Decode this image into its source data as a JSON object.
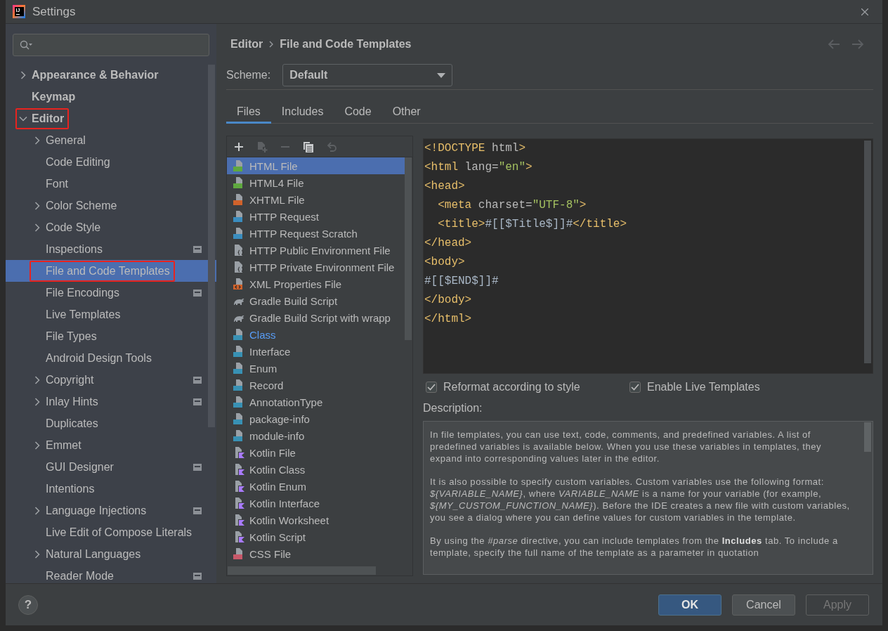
{
  "window": {
    "title": "Settings",
    "logo_text": "IJ"
  },
  "sidebar": {
    "items": [
      {
        "label": "Appearance & Behavior",
        "expanded": false,
        "selected": false,
        "marked": false,
        "project_setting": false
      },
      {
        "label": "Keymap",
        "selected": false,
        "marked": false,
        "project_setting": false
      },
      {
        "label": "Editor",
        "expanded": true,
        "selected": false,
        "marked": true,
        "project_setting": false,
        "children": [
          {
            "label": "General",
            "expanded": false,
            "selected": false,
            "marked": false,
            "project_setting": false
          },
          {
            "label": "Code Editing",
            "selected": false,
            "marked": false,
            "project_setting": false
          },
          {
            "label": "Font",
            "selected": false,
            "marked": false,
            "project_setting": false
          },
          {
            "label": "Color Scheme",
            "expanded": false,
            "selected": false,
            "marked": false,
            "project_setting": false
          },
          {
            "label": "Code Style",
            "expanded": false,
            "selected": false,
            "marked": false,
            "project_setting": false
          },
          {
            "label": "Inspections",
            "selected": false,
            "marked": false,
            "project_setting": true
          },
          {
            "label": "File and Code Templates",
            "selected": true,
            "marked": true,
            "project_setting": false
          },
          {
            "label": "File Encodings",
            "selected": false,
            "marked": false,
            "project_setting": true
          },
          {
            "label": "Live Templates",
            "selected": false,
            "marked": false,
            "project_setting": false
          },
          {
            "label": "File Types",
            "selected": false,
            "marked": false,
            "project_setting": false
          },
          {
            "label": "Android Design Tools",
            "selected": false,
            "marked": false,
            "project_setting": false
          },
          {
            "label": "Copyright",
            "expanded": false,
            "selected": false,
            "marked": false,
            "project_setting": true
          },
          {
            "label": "Inlay Hints",
            "expanded": false,
            "selected": false,
            "marked": false,
            "project_setting": true
          },
          {
            "label": "Duplicates",
            "selected": false,
            "marked": false,
            "project_setting": false
          },
          {
            "label": "Emmet",
            "expanded": false,
            "selected": false,
            "marked": false,
            "project_setting": false
          },
          {
            "label": "GUI Designer",
            "selected": false,
            "marked": false,
            "project_setting": true
          },
          {
            "label": "Intentions",
            "selected": false,
            "marked": false,
            "project_setting": false
          },
          {
            "label": "Language Injections",
            "expanded": false,
            "selected": false,
            "marked": false,
            "project_setting": true
          },
          {
            "label": "Live Edit of Compose Literals",
            "selected": false,
            "marked": false,
            "project_setting": false
          },
          {
            "label": "Natural Languages",
            "expanded": false,
            "selected": false,
            "marked": false,
            "project_setting": false
          },
          {
            "label": "Reader Mode",
            "selected": false,
            "marked": false,
            "project_setting": true
          }
        ]
      }
    ]
  },
  "content": {
    "breadcrumb": [
      "Editor",
      "File and Code Templates"
    ],
    "nav_buttons": [
      {
        "kind": "back",
        "disabled": true
      },
      {
        "kind": "forward",
        "disabled": true
      }
    ],
    "scheme": {
      "label": "Scheme:",
      "value": "Default"
    },
    "tabs": [
      {
        "label": "Files",
        "selected": true
      },
      {
        "label": "Includes",
        "selected": false
      },
      {
        "label": "Code",
        "selected": false
      },
      {
        "label": "Other",
        "selected": false
      }
    ],
    "toolbar": [
      {
        "kind": "add",
        "disabled": false
      },
      {
        "kind": "add_child",
        "disabled": true
      },
      {
        "kind": "remove",
        "disabled": true
      },
      {
        "kind": "copy",
        "disabled": false
      },
      {
        "kind": "reset",
        "disabled": true
      }
    ],
    "templates": [
      {
        "name": "HTML File",
        "kind": "html",
        "selected": true,
        "modified": false
      },
      {
        "name": "HTML4 File",
        "kind": "html",
        "selected": false,
        "modified": false
      },
      {
        "name": "XHTML File",
        "kind": "xhtml",
        "selected": false,
        "modified": false
      },
      {
        "name": "HTTP Request",
        "kind": "api",
        "selected": false,
        "modified": false
      },
      {
        "name": "HTTP Request Scratch",
        "kind": "api",
        "selected": false,
        "modified": false
      },
      {
        "name": "HTTP Public Environment File",
        "kind": "env",
        "selected": false,
        "modified": false
      },
      {
        "name": "HTTP Private Environment File",
        "kind": "env",
        "selected": false,
        "modified": false
      },
      {
        "name": "XML Properties File",
        "kind": "xml",
        "selected": false,
        "modified": false
      },
      {
        "name": "Gradle Build Script",
        "kind": "gradle",
        "selected": false,
        "modified": false
      },
      {
        "name": "Gradle Build Script with wrapp",
        "kind": "gradle",
        "selected": false,
        "modified": false
      },
      {
        "name": "Class",
        "kind": "java",
        "selected": false,
        "modified": true
      },
      {
        "name": "Interface",
        "kind": "java",
        "selected": false,
        "modified": false
      },
      {
        "name": "Enum",
        "kind": "java",
        "selected": false,
        "modified": false
      },
      {
        "name": "Record",
        "kind": "java",
        "selected": false,
        "modified": false
      },
      {
        "name": "AnnotationType",
        "kind": "java",
        "selected": false,
        "modified": false
      },
      {
        "name": "package-info",
        "kind": "java",
        "selected": false,
        "modified": false
      },
      {
        "name": "module-info",
        "kind": "java",
        "selected": false,
        "modified": false
      },
      {
        "name": "Kotlin File",
        "kind": "kotlin",
        "selected": false,
        "modified": false
      },
      {
        "name": "Kotlin Class",
        "kind": "kotlin",
        "selected": false,
        "modified": false
      },
      {
        "name": "Kotlin Enum",
        "kind": "kotlin",
        "selected": false,
        "modified": false
      },
      {
        "name": "Kotlin Interface",
        "kind": "kotlin",
        "selected": false,
        "modified": false
      },
      {
        "name": "Kotlin Worksheet",
        "kind": "kotlin",
        "selected": false,
        "modified": false
      },
      {
        "name": "Kotlin Script",
        "kind": "kotlin",
        "selected": false,
        "modified": false
      },
      {
        "name": "CSS File",
        "kind": "css",
        "selected": false,
        "modified": false
      }
    ],
    "editor": {
      "lines": [
        [
          {
            "text": "<!DOCTYPE",
            "kind": "tag"
          },
          {
            "text": " html",
            "kind": "attr"
          },
          {
            "text": ">",
            "kind": "tag"
          }
        ],
        [
          {
            "text": "<html",
            "kind": "tag"
          },
          {
            "text": " lang=",
            "kind": "attr"
          },
          {
            "text": "\"en\"",
            "kind": "value"
          },
          {
            "text": ">",
            "kind": "tag"
          }
        ],
        [
          {
            "text": "<head>",
            "kind": "tag"
          }
        ],
        [
          {
            "text": "  <meta",
            "kind": "tag"
          },
          {
            "text": " charset=",
            "kind": "attr"
          },
          {
            "text": "\"UTF-8\"",
            "kind": "value"
          },
          {
            "text": ">",
            "kind": "tag"
          }
        ],
        [
          {
            "text": "  <title>",
            "kind": "tag"
          },
          {
            "text": "#[[$Title$]]#",
            "kind": "text"
          },
          {
            "text": "</title>",
            "kind": "tag"
          }
        ],
        [
          {
            "text": "</head>",
            "kind": "tag"
          }
        ],
        [
          {
            "text": "<body>",
            "kind": "tag"
          }
        ],
        [
          {
            "text": "#[[$END$]]#",
            "kind": "text"
          }
        ],
        [
          {
            "text": "</body>",
            "kind": "tag"
          }
        ],
        [
          {
            "text": "</html>",
            "kind": "tag"
          }
        ]
      ]
    },
    "options": [
      {
        "label": "Reformat according to style",
        "checked": true
      },
      {
        "label": "Enable Live Templates",
        "checked": true
      }
    ],
    "description": {
      "label": "Description:",
      "paragraphs": [
        "In file templates, you can use text, code, comments, and predefined variables. A list of predefined variables is available below. When you use these variables in templates, they expand into corresponding values later in the editor.",
        "It is also possible to specify custom variables. Custom variables use the following format: *${VARIABLE_NAME}*, where *VARIABLE_NAME* is a name for your variable (for example, *${MY_CUSTOM_FUNCTION_NAME}*). Before the IDE creates a new file with custom variables, you see a dialog where you can define values for custom variables in the template.",
        "By using the *#parse* directive, you can include templates from the **Includes** tab. To include a template, specify the full name of the template as a parameter in quotation"
      ]
    }
  },
  "footer": {
    "help": "?",
    "buttons": [
      {
        "label": "OK",
        "primary": true,
        "disabled": false
      },
      {
        "label": "Cancel",
        "primary": false,
        "disabled": false
      },
      {
        "label": "Apply",
        "primary": false,
        "disabled": true
      }
    ]
  }
}
